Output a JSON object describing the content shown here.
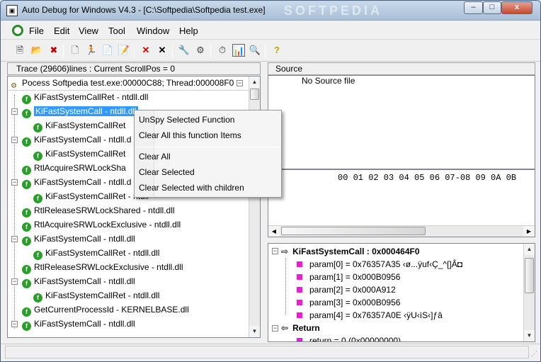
{
  "window": {
    "title": "Auto Debug for Windows V4.3 - [C:\\Softpedia\\Softpedia test.exe]",
    "watermark": "SOFTPEDIA",
    "app_icon": "debugger-app-icon",
    "buttons": {
      "minimize": "–",
      "maximize": "□",
      "close": "x"
    }
  },
  "menubar": {
    "items": [
      "File",
      "Edit",
      "View",
      "Tool",
      "Window",
      "Help"
    ]
  },
  "toolbar": {
    "icons": [
      "open-exe-icon",
      "open-folder-icon",
      "close-file-icon",
      "new-file-icon",
      "run-icon",
      "notes-icon",
      "edit-doc-icon",
      "delete-red-icon",
      "clear-all-icon",
      "tools-icon",
      "settings-icon",
      "timer-icon",
      "report-icon",
      "magnify-icon",
      "help-icon"
    ],
    "glyphs": [
      "🗎",
      "📂",
      "✖",
      "🗋",
      "🏃",
      "📄",
      "📝",
      "✕",
      "✕",
      "🔧",
      "⚙",
      "⏱",
      "📊",
      "🔍",
      "?"
    ]
  },
  "trace": {
    "header": "Trace (29606)lines : Current ScrollPos = 0",
    "process": "Pocess Softpedia test.exe:00000C88; Thread:000008F0",
    "rows": [
      "KiFastSystemCallRet - ntdll.dll",
      "KiFastSystemCall - ntdll.dll",
      "KiFastSystemCallRet",
      "KiFastSystemCall - ntdll.d",
      "KiFastSystemCallRet",
      "RtlAcquireSRWLockSha",
      "KiFastSystemCall - ntdll.d",
      "KiFastSystemCallRet - ntdll",
      "RtlReleaseSRWLockShared - ntdll.dll",
      "RtlAcquireSRWLockExclusive - ntdll.dll",
      "KiFastSystemCall - ntdll.dll",
      "KiFastSystemCallRet - ntdll.dll",
      "RtlReleaseSRWLockExclusive - ntdll.dll",
      "KiFastSystemCall - ntdll.dll",
      "KiFastSystemCallRet - ntdll.dll",
      "GetCurrentProcessId - KERNELBASE.dll",
      "KiFastSystemCall - ntdll.dll"
    ],
    "selected_index": 1
  },
  "source": {
    "header": "Source",
    "text": "No Source file"
  },
  "hex": {
    "header": "00 01 02 03 04 05 06 07-08 09 0A 0B"
  },
  "params": {
    "function": "KiFastSystemCall : 0x000464F0",
    "items": [
      "param[0] = 0x76357A35 ‹ø...ÿuf‹Ç_^[]Â◘",
      "param[1] = 0x000B0956",
      "param[2] = 0x000A912",
      "param[3] = 0x000B0956",
      "param[4] = 0x76357A0E ‹ÿU‹ìS‹]ƒâ"
    ],
    "return_label": "Return",
    "return_value": "return = 0 (0x00000000)"
  },
  "context_menu": {
    "items": [
      "UnSpy Selected Function",
      "Clear All this function Items",
      "Clear All",
      "Clear Selected",
      "Clear Selected with children"
    ]
  }
}
